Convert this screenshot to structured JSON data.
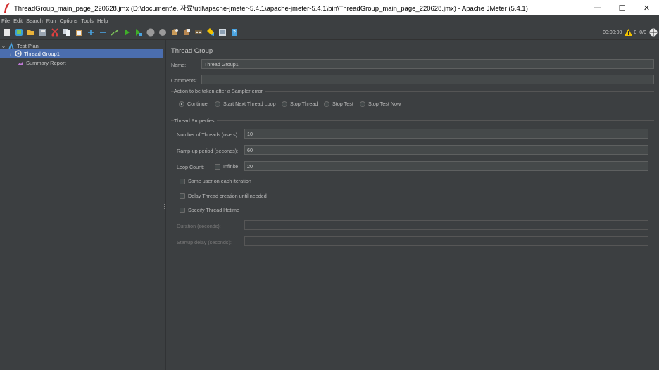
{
  "window": {
    "title": "ThreadGroup_main_page_220628.jmx (D:\\document\\e. 자료\\util\\apache-jmeter-5.4.1\\apache-jmeter-5.4.1\\bin\\ThreadGroup_main_page_220628.jmx) - Apache JMeter (5.4.1)",
    "minimize": "—",
    "maximize": "☐",
    "close": "✕"
  },
  "menu": [
    "File",
    "Edit",
    "Search",
    "Run",
    "Options",
    "Tools",
    "Help"
  ],
  "toolbar": {
    "timer": "00:00:00",
    "warnings": "0",
    "threads": "0/0",
    "icons": [
      "new-icon",
      "templates-icon",
      "open-icon",
      "save-icon",
      "cut-icon",
      "copy-icon",
      "paste-icon",
      "expand-icon",
      "collapse-icon",
      "toggle-icon",
      "start-icon",
      "start-no-pause-icon",
      "stop-icon",
      "shutdown-icon",
      "clear-icon",
      "clear-all-icon",
      "search-icon",
      "reset-search-icon",
      "function-helper-icon",
      "help-icon"
    ]
  },
  "tree": {
    "items": [
      {
        "label": "Test Plan",
        "icon": "test-plan-icon"
      },
      {
        "label": "Thread Group1",
        "icon": "thread-group-icon"
      },
      {
        "label": "Summary Report",
        "icon": "summary-report-icon"
      }
    ]
  },
  "panel": {
    "title": "Thread Group",
    "name_label": "Name:",
    "name_value": "Thread Group1",
    "comments_label": "Comments:",
    "comments_value": "",
    "error_group_title": "Action to be taken after a Sampler error",
    "error_actions": [
      {
        "label": "Continue",
        "selected": true
      },
      {
        "label": "Start Next Thread Loop",
        "selected": false
      },
      {
        "label": "Stop Thread",
        "selected": false
      },
      {
        "label": "Stop Test",
        "selected": false
      },
      {
        "label": "Stop Test Now",
        "selected": false
      }
    ],
    "props_group_title": "Thread Properties",
    "threads_label": "Number of Threads (users):",
    "threads_value": "10",
    "rampup_label": "Ramp-up period (seconds):",
    "rampup_value": "60",
    "loop_label": "Loop Count:",
    "infinite_label": "Infinite",
    "loop_value": "20",
    "same_user_label": "Same user on each iteration",
    "delay_label": "Delay Thread creation until needed",
    "lifetime_label": "Specify Thread lifetime",
    "duration_label": "Duration (seconds):",
    "startup_label": "Startup delay (seconds):"
  },
  "colors": {
    "background": "#3c3f41",
    "selection": "#4b6eaf",
    "field": "#45494a",
    "warning": "#f2c200",
    "start_green": "#3fae29"
  }
}
